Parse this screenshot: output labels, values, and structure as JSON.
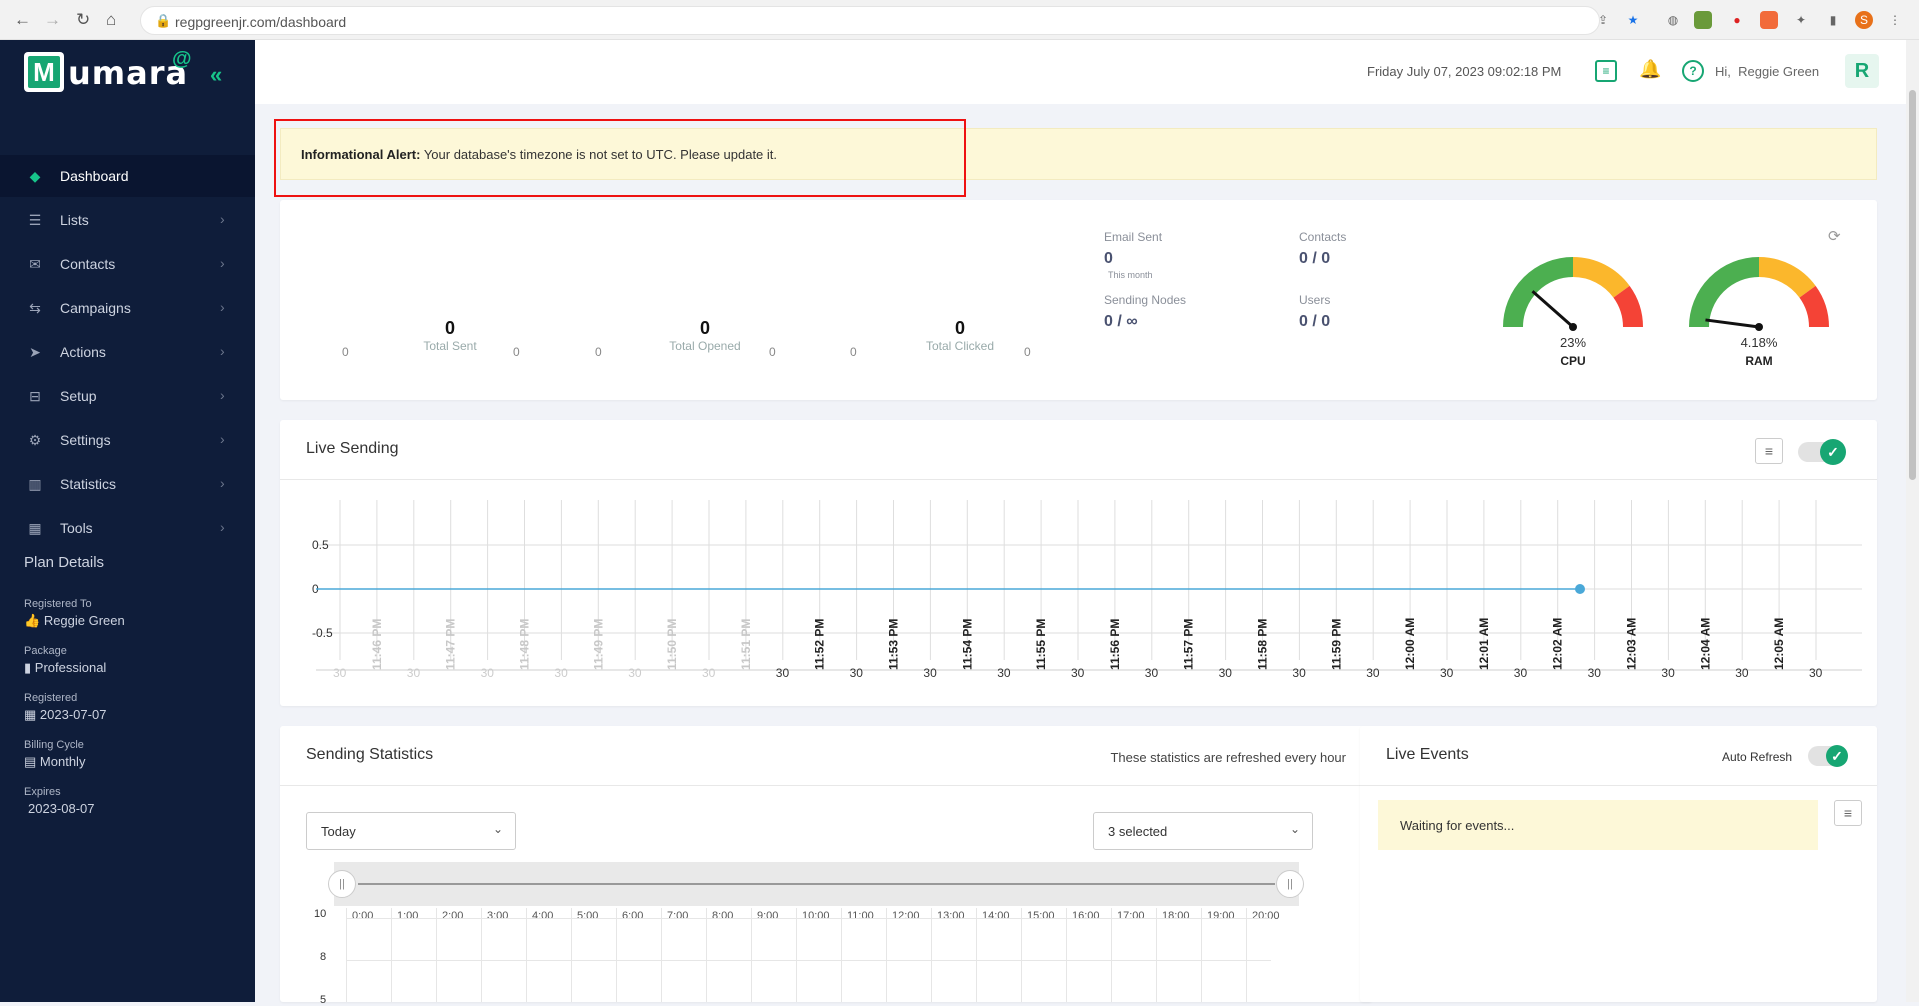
{
  "browser": {
    "url": "regpgreenjr.com/dashboard",
    "profile_initial": "S"
  },
  "sidebar": {
    "logo_letter": "M",
    "logo_word": "umara",
    "logo_at": "@",
    "items": [
      {
        "label": "Dashboard",
        "icon": "diamond-icon",
        "glyph": "◆",
        "active": true
      },
      {
        "label": "Lists",
        "icon": "list-icon",
        "glyph": "☰"
      },
      {
        "label": "Contacts",
        "icon": "envelope-icon",
        "glyph": "✉"
      },
      {
        "label": "Campaigns",
        "icon": "exchange-icon",
        "glyph": "⇆"
      },
      {
        "label": "Actions",
        "icon": "send-icon",
        "glyph": "➤"
      },
      {
        "label": "Setup",
        "icon": "toggle-icon",
        "glyph": "⊟"
      },
      {
        "label": "Settings",
        "icon": "gear-icon",
        "glyph": "⚙"
      },
      {
        "label": "Statistics",
        "icon": "bar-chart-icon",
        "glyph": "▥"
      },
      {
        "label": "Tools",
        "icon": "grid-icon",
        "glyph": "▦"
      }
    ],
    "plan": {
      "title": "Plan Details",
      "registered_to_label": "Registered To",
      "registered_to": "Reggie Green",
      "package_label": "Package",
      "package": "Professional",
      "registered_label": "Registered",
      "registered": "2023-07-07",
      "billing_label": "Billing Cycle",
      "billing": "Monthly",
      "expires_label": "Expires",
      "expires": "2023-08-07"
    }
  },
  "topbar": {
    "datetime": "Friday July 07, 2023 09:02:18 PM",
    "greeting": "Hi,",
    "user": "Reggie Green",
    "avatar": "R"
  },
  "alert": {
    "bold": "Informational Alert:",
    "text": "Your database's timezone is not set to UTC. Please update it."
  },
  "stats": {
    "sent": {
      "value": "0",
      "label": "Total Sent",
      "left": "0",
      "right": "0"
    },
    "opened": {
      "value": "0",
      "label": "Total Opened",
      "left": "0",
      "right": "0"
    },
    "clicked": {
      "value": "0",
      "label": "Total Clicked",
      "left": "0",
      "right": "0"
    },
    "summary": {
      "email_sent_label": "Email Sent",
      "email_sent": "0",
      "email_sent_sub": "This month",
      "contacts_label": "Contacts",
      "contacts": "0 / 0",
      "nodes_label": "Sending Nodes",
      "nodes": "0 / ∞",
      "users_label": "Users",
      "users": "0 / 0"
    },
    "cpu": {
      "label": "CPU",
      "pct": "23%",
      "value": 23
    },
    "ram": {
      "label": "RAM",
      "pct": "4.18%",
      "value": 4.18
    },
    "colors": {
      "green": "#4caf50",
      "amber": "#fbb72c",
      "red": "#f44336"
    }
  },
  "live_sending": {
    "title": "Live Sending"
  },
  "chart_data": {
    "type": "line",
    "title": "Live Sending",
    "y_ticks": [
      "0.5",
      "0",
      "-0.5"
    ],
    "ylim": [
      -0.5,
      0.5
    ],
    "x_ticks": [
      "30",
      "11:46 PM",
      "30",
      "11:47 PM",
      "30",
      "11:48 PM",
      "30",
      "11:49 PM",
      "30",
      "11:50 PM",
      "30",
      "11:51 PM",
      "30",
      "11:52 PM",
      "30",
      "11:53 PM",
      "30",
      "11:54 PM",
      "30",
      "11:55 PM",
      "30",
      "11:56 PM",
      "30",
      "11:57 PM",
      "30",
      "11:58 PM",
      "30",
      "11:59 PM",
      "30",
      "12:00 AM",
      "30",
      "12:01 AM",
      "30",
      "12:02 AM",
      "30",
      "12:03 AM",
      "30",
      "12:04 AM",
      "30",
      "12:05 AM",
      "30"
    ],
    "series": [
      {
        "values": [
          0
        ],
        "color": "#4aa8d8"
      }
    ],
    "grid": true
  },
  "sending_statistics": {
    "title": "Sending Statistics",
    "note": "These statistics are refreshed every hour",
    "period": "Today",
    "selected": "3 selected",
    "hours": [
      "0:00",
      "1:00",
      "2:00",
      "3:00",
      "4:00",
      "5:00",
      "6:00",
      "7:00",
      "8:00",
      "9:00",
      "10:00",
      "11:00",
      "12:00",
      "13:00",
      "14:00",
      "15:00",
      "16:00",
      "17:00",
      "18:00",
      "19:00",
      "20:00"
    ],
    "y_ticks": [
      "10",
      "8",
      "5"
    ]
  },
  "live_events": {
    "title": "Live Events",
    "auto_refresh": "Auto Refresh",
    "waiting": "Waiting for events..."
  }
}
